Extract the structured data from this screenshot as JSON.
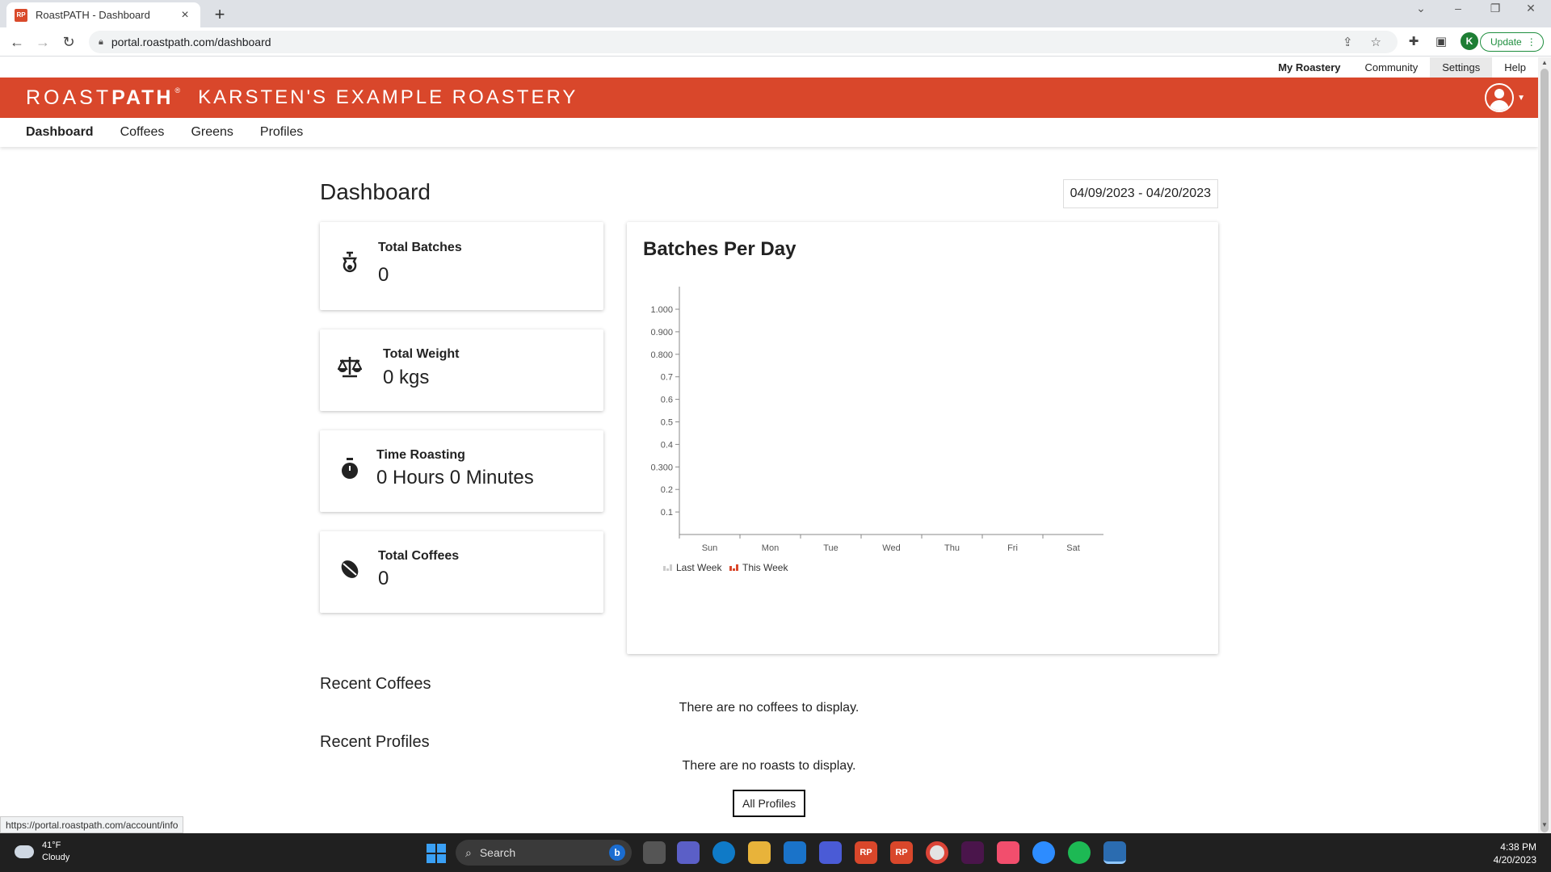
{
  "browser": {
    "tab_title": "RoastPATH - Dashboard",
    "favicon_text": "RP",
    "url": "portal.roastpath.com/dashboard",
    "update_label": "Update",
    "profile_initial": "K"
  },
  "topnav": {
    "items": [
      "My Roastery",
      "Community",
      "Settings",
      "Help"
    ]
  },
  "brand": {
    "logo_light": "ROAST",
    "logo_bold": "PATH",
    "logo_mark": "®",
    "roastery_name": "KARSTEN'S EXAMPLE ROASTERY",
    "color": "#d9472b"
  },
  "subnav": {
    "items": [
      "Dashboard",
      "Coffees",
      "Greens",
      "Profiles"
    ]
  },
  "dashboard": {
    "title": "Dashboard",
    "date_range": "04/09/2023 - 04/20/2023",
    "stats": [
      {
        "label": "Total Batches",
        "value": "0",
        "icon": "batch-icon"
      },
      {
        "label": "Total Weight",
        "value": "0 kgs",
        "icon": "scale-icon"
      },
      {
        "label": "Time Roasting",
        "value": "0 Hours 0 Minutes",
        "icon": "stopwatch-icon"
      },
      {
        "label": "Total Coffees",
        "value": "0",
        "icon": "coffee-bean-icon"
      }
    ],
    "recent_coffees_title": "Recent Coffees",
    "recent_coffees_empty": "There are no coffees to display.",
    "recent_profiles_title": "Recent Profiles",
    "recent_profiles_empty": "There are no roasts to display.",
    "all_profiles_label": "All Profiles"
  },
  "chart_data": {
    "type": "bar",
    "title": "Batches Per Day",
    "categories": [
      "Sun",
      "Mon",
      "Tue",
      "Wed",
      "Thu",
      "Fri",
      "Sat"
    ],
    "y_ticks": [
      "0.1",
      "0.2",
      "0.300",
      "0.4",
      "0.5",
      "0.6",
      "0.7",
      "0.800",
      "0.900",
      "1.000"
    ],
    "ylim": [
      0,
      1
    ],
    "series": [
      {
        "name": "Last Week",
        "values": [
          0,
          0,
          0,
          0,
          0,
          0,
          0
        ],
        "color": "#cccccc"
      },
      {
        "name": "This Week",
        "values": [
          0,
          0,
          0,
          0,
          0,
          0,
          0
        ],
        "color": "#d9472b"
      }
    ],
    "legend": "bottom-left",
    "grid": false
  },
  "status_url": "https://portal.roastpath.com/account/info",
  "taskbar": {
    "temperature": "41°F",
    "condition": "Cloudy",
    "search_label": "Search",
    "bing_letter": "b",
    "time": "4:38 PM",
    "date": "4/20/2023",
    "app_labels": [
      "RP",
      "RP"
    ]
  }
}
